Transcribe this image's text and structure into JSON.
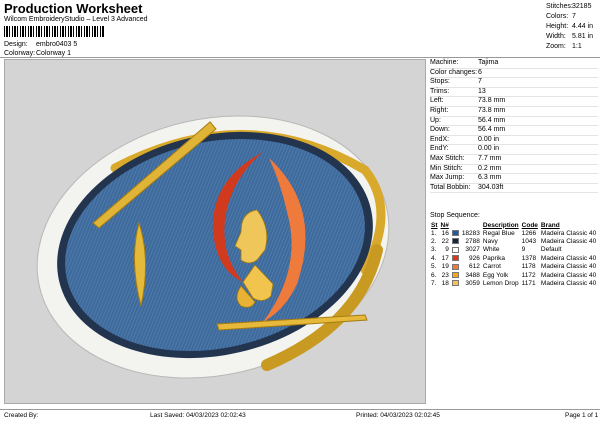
{
  "header": {
    "title": "Production Worksheet",
    "subtitle": "Wilcom EmbroideryStudio – Level 3 Advanced",
    "design_label": "Design:",
    "design_value": "embro0403 5",
    "colorway_label": "Colorway:",
    "colorway_value": "Colorway 1"
  },
  "stats": [
    {
      "label": "Stitches:",
      "value": "32185"
    },
    {
      "label": "Colors:",
      "value": "7"
    },
    {
      "label": "Height:",
      "value": "4.44 in"
    },
    {
      "label": "Width:",
      "value": "5.81 in"
    },
    {
      "label": "Zoom:",
      "value": "1:1"
    }
  ],
  "machine_info": [
    {
      "label": "Machine:",
      "value": "Tajima"
    },
    {
      "label": "Color changes:",
      "value": "6"
    },
    {
      "label": "Stops:",
      "value": "7"
    },
    {
      "label": "Trims:",
      "value": "13"
    },
    {
      "label": "Left:",
      "value": "73.8 mm"
    },
    {
      "label": "Right:",
      "value": "73.8 mm"
    },
    {
      "label": "Up:",
      "value": "56.4 mm"
    },
    {
      "label": "Down:",
      "value": "56.4 mm"
    },
    {
      "label": "EndX:",
      "value": "0.00 in"
    },
    {
      "label": "EndY:",
      "value": "0.00 in"
    },
    {
      "label": "Max Stitch:",
      "value": "7.7 mm"
    },
    {
      "label": "Min Stitch:",
      "value": "0.2 mm"
    },
    {
      "label": "Max Jump:",
      "value": "6.3 mm"
    },
    {
      "label": "Total Bobbin:",
      "value": "304.03ft"
    }
  ],
  "stop_sequence": {
    "title": "Stop Sequence:",
    "columns": [
      "St",
      "N#",
      "",
      "Description",
      "Code",
      "Brand"
    ],
    "rows": [
      {
        "st": "1.",
        "n": "16",
        "color": "#1f5aa0",
        "count": "18283",
        "desc": "Regal Blue",
        "code": "1266",
        "brand": "Madeira Classic 40"
      },
      {
        "st": "2.",
        "n": "22",
        "color": "#1a2540",
        "count": "2788",
        "desc": "Navy",
        "code": "1043",
        "brand": "Madeira Classic 40"
      },
      {
        "st": "3.",
        "n": "9",
        "color": "#ffffff",
        "count": "3027",
        "desc": "White",
        "code": "9",
        "brand": "Default"
      },
      {
        "st": "4.",
        "n": "17",
        "color": "#d9381e",
        "count": "926",
        "desc": "Paprika",
        "code": "1378",
        "brand": "Madeira Classic 40"
      },
      {
        "st": "5.",
        "n": "19",
        "color": "#ee7a3c",
        "count": "612",
        "desc": "Carrot",
        "code": "1178",
        "brand": "Madeira Classic 40"
      },
      {
        "st": "6.",
        "n": "23",
        "color": "#f2a81c",
        "count": "3488",
        "desc": "Egg Yolk",
        "code": "1172",
        "brand": "Madeira Classic 40"
      },
      {
        "st": "7.",
        "n": "18",
        "color": "#f3c25a",
        "count": "3059",
        "desc": "Lemon Drop",
        "code": "1171",
        "brand": "Madeira Classic 40"
      }
    ]
  },
  "footer": {
    "created_by": "Created By:",
    "last_saved": "Last Saved: 04/03/2023 02:02:43",
    "printed": "Printed: 04/03/2023 02:02:45",
    "page": "Page 1 of 1"
  }
}
